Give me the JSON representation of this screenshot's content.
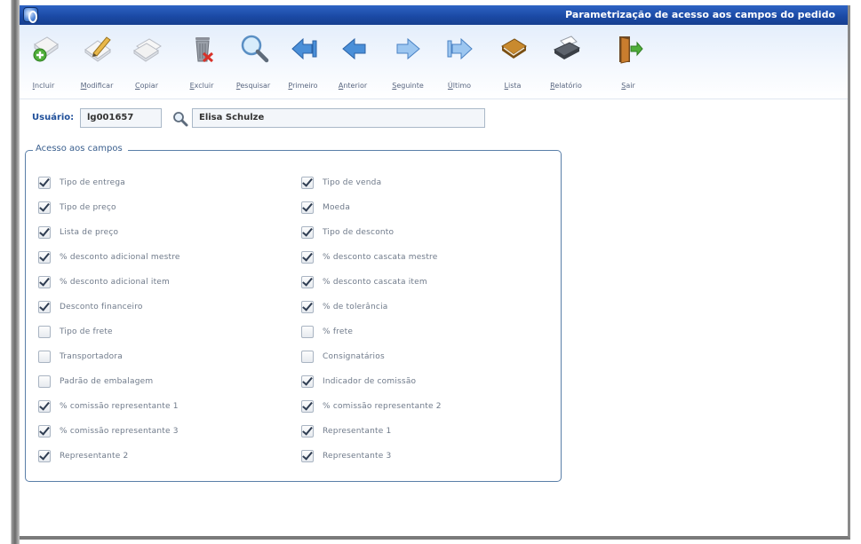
{
  "window": {
    "title": "Parametrização de acesso aos campos do pedido"
  },
  "toolbar": {
    "buttons": [
      {
        "label": "Incluir",
        "icon": "add-document-icon"
      },
      {
        "label": "Modificar",
        "icon": "edit-pencil-icon"
      },
      {
        "label": "Copiar",
        "icon": "copy-documents-icon"
      },
      {
        "label": "Excluir",
        "icon": "trash-delete-icon"
      },
      {
        "label": "Pesquisar",
        "icon": "magnifier-search-icon"
      },
      {
        "label": "Primeiro",
        "icon": "first-record-icon"
      },
      {
        "label": "Anterior",
        "icon": "previous-arrow-icon"
      },
      {
        "label": "Seguinte",
        "icon": "next-arrow-icon"
      },
      {
        "label": "Último",
        "icon": "last-record-icon"
      },
      {
        "label": "Lista",
        "icon": "book-list-icon"
      },
      {
        "label": "Relatório",
        "icon": "printer-report-icon"
      },
      {
        "label": "Sair",
        "icon": "exit-door-icon"
      }
    ]
  },
  "user": {
    "label": "Usuário:",
    "code": "lg001657",
    "name": "Elisa Schulze"
  },
  "fields_group": {
    "legend": "Acesso aos campos",
    "left": [
      {
        "label": "Tipo de entrega",
        "checked": true
      },
      {
        "label": "Tipo de preço",
        "checked": true
      },
      {
        "label": "Lista de preço",
        "checked": true
      },
      {
        "label": "% desconto adicional mestre",
        "checked": true
      },
      {
        "label": "% desconto adicional item",
        "checked": true
      },
      {
        "label": "Desconto financeiro",
        "checked": true
      },
      {
        "label": "Tipo de frete",
        "checked": false
      },
      {
        "label": "Transportadora",
        "checked": false
      },
      {
        "label": "Padrão de embalagem",
        "checked": false
      },
      {
        "label": "% comissão representante 1",
        "checked": true
      },
      {
        "label": "% comissão representante 3",
        "checked": true
      },
      {
        "label": "Representante 2",
        "checked": true
      }
    ],
    "right": [
      {
        "label": "Tipo de venda",
        "checked": true
      },
      {
        "label": "Moeda",
        "checked": true
      },
      {
        "label": "Tipo de desconto",
        "checked": true
      },
      {
        "label": "% desconto cascata mestre",
        "checked": true
      },
      {
        "label": "% desconto cascata item",
        "checked": true
      },
      {
        "label": "% de tolerância",
        "checked": true
      },
      {
        "label": "% frete",
        "checked": false
      },
      {
        "label": "Consignatários",
        "checked": false
      },
      {
        "label": "Indicador de comissão",
        "checked": true
      },
      {
        "label": "% comissão representante 2",
        "checked": true
      },
      {
        "label": "Representante 1",
        "checked": true
      },
      {
        "label": "Representante 3",
        "checked": true
      }
    ]
  }
}
